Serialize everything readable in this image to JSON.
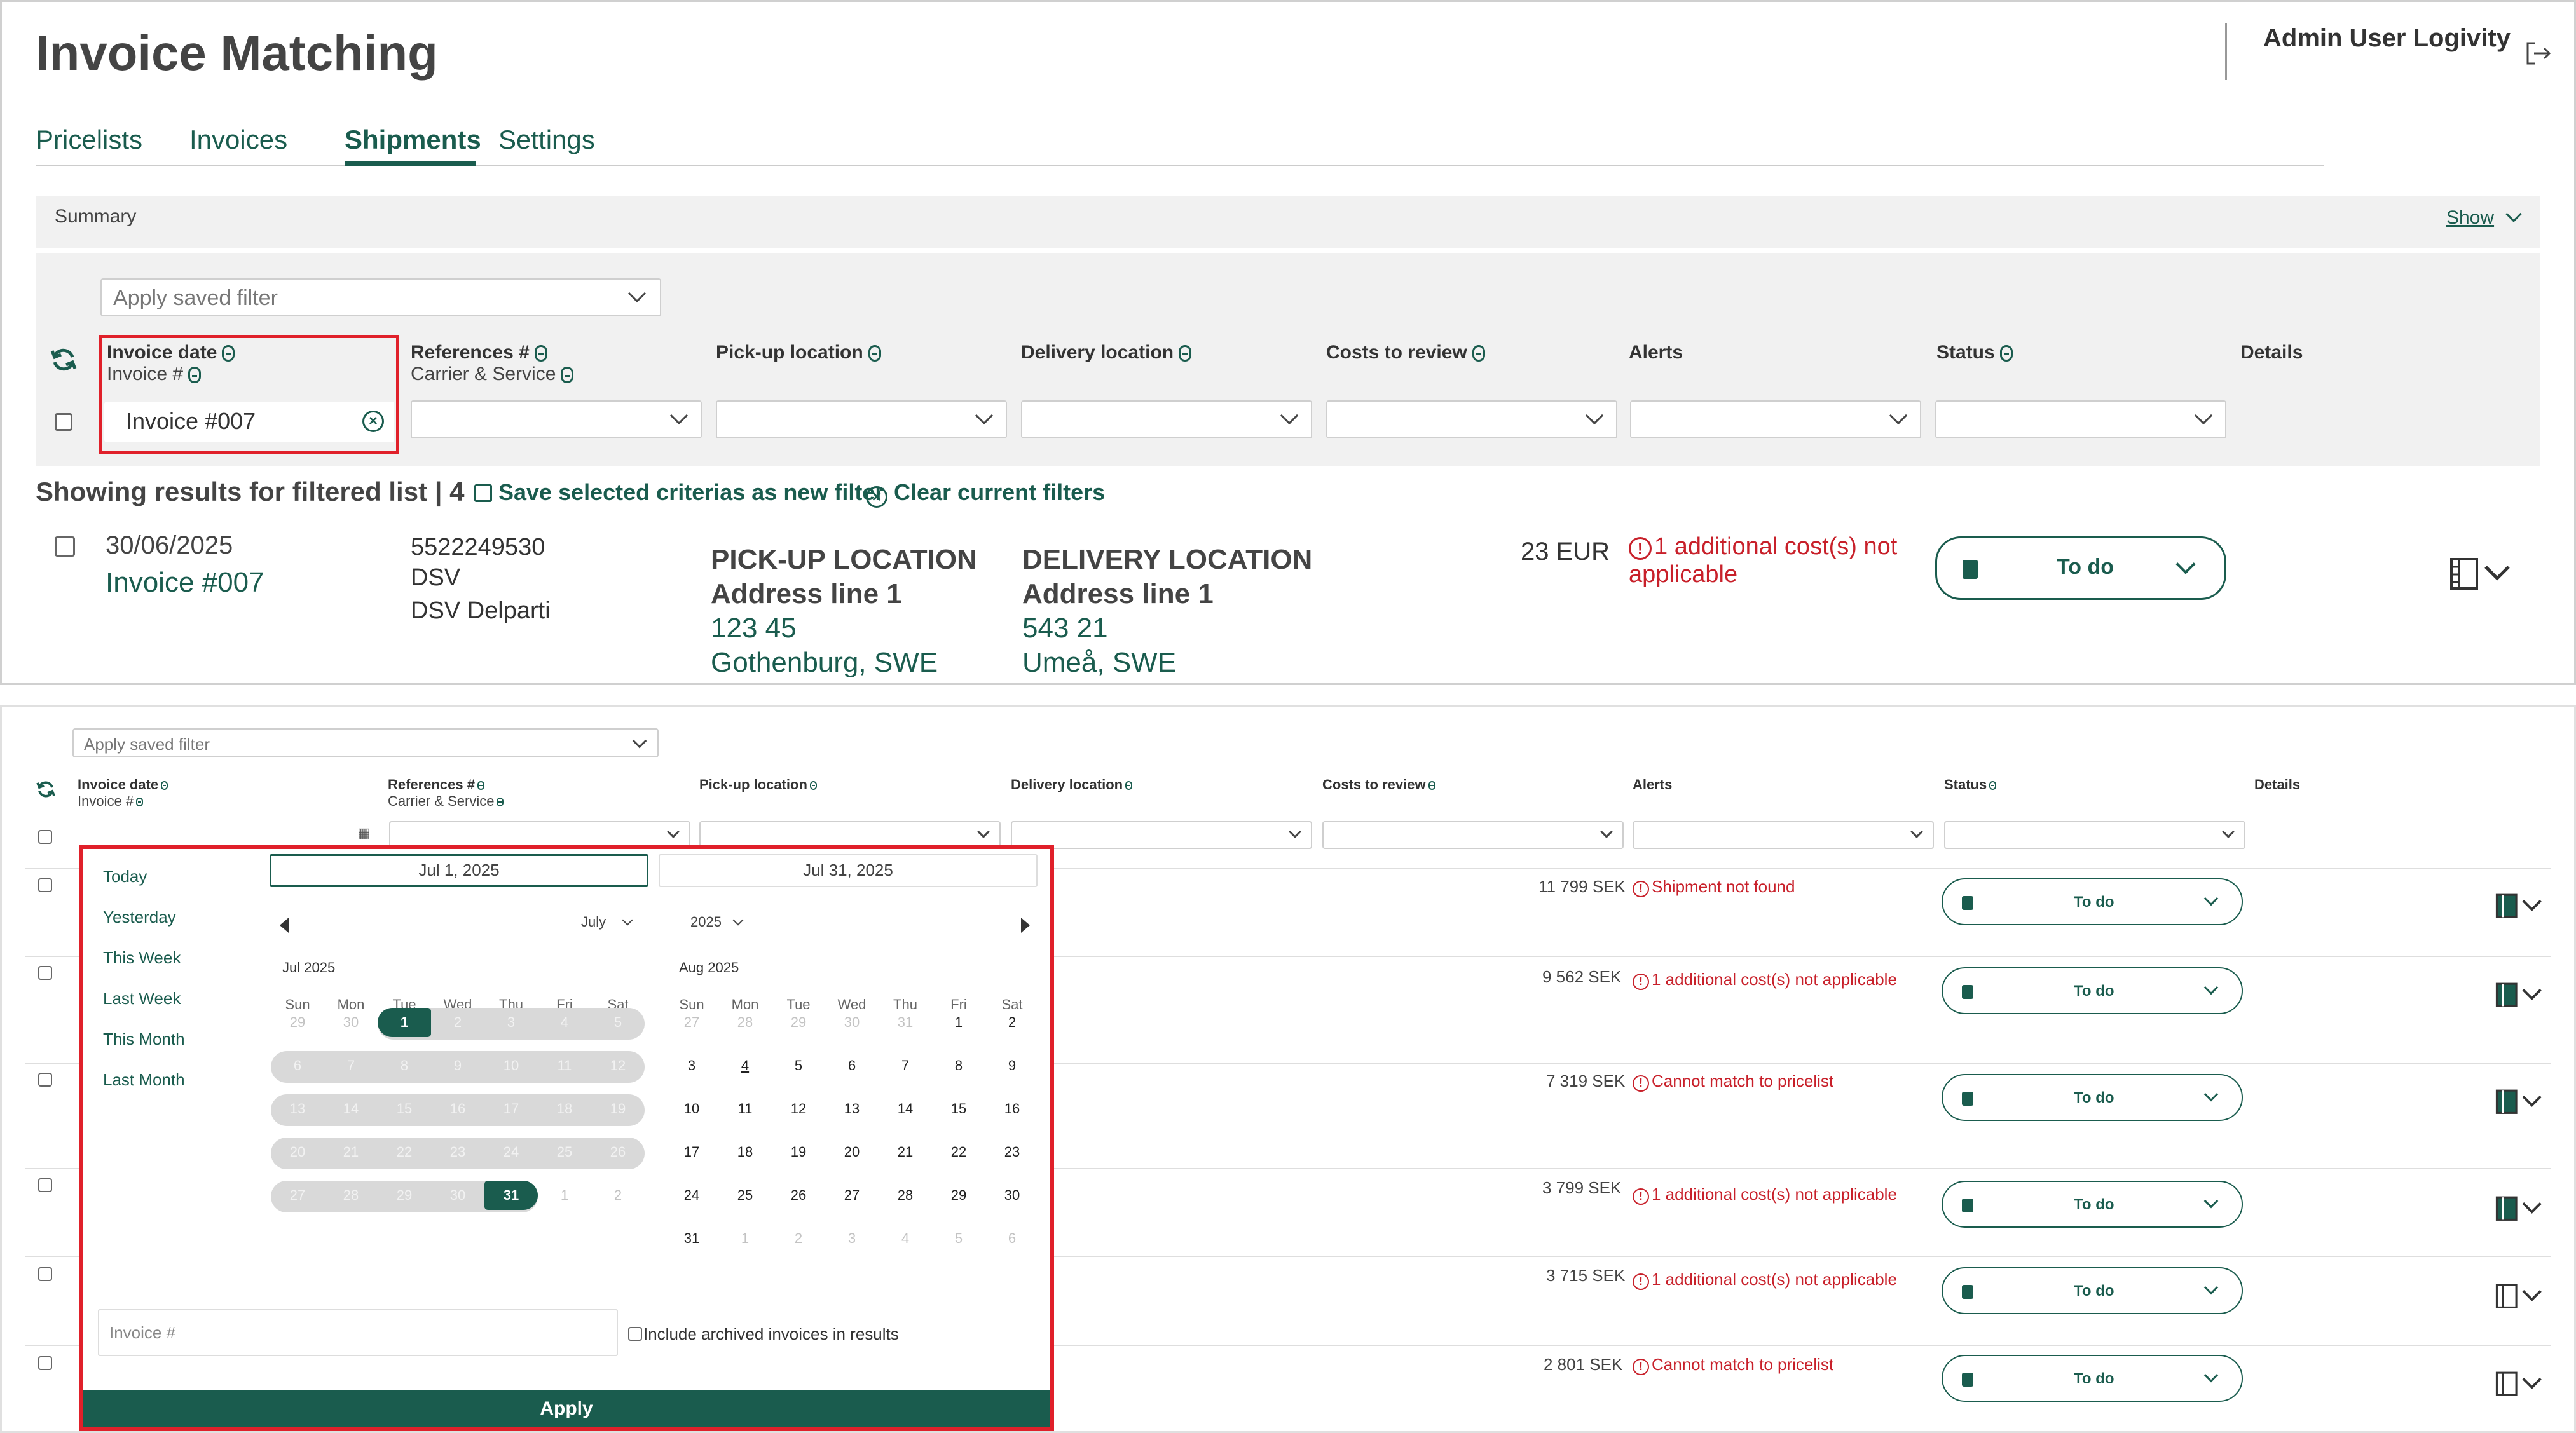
{
  "header": {
    "title": "Invoice Matching",
    "user": "Admin User Logivity"
  },
  "tabs": [
    {
      "label": "Pricelists"
    },
    {
      "label": "Invoices"
    },
    {
      "label": "Shipments",
      "active": true
    },
    {
      "label": "Settings"
    }
  ],
  "summary": {
    "label": "Summary",
    "toggle": "Show"
  },
  "filters": {
    "saved_filter_placeholder": "Apply saved filter",
    "invoice_value": "Invoice #007",
    "columns": {
      "invoice_date": "Invoice date",
      "invoice_no": "Invoice #",
      "references": "References #",
      "carrier_service": "Carrier & Service",
      "pickup": "Pick-up location",
      "delivery": "Delivery location",
      "costs": "Costs to review",
      "alerts": "Alerts",
      "status": "Status",
      "details": "Details"
    }
  },
  "results": {
    "heading": "Showing results for filtered list | 4",
    "save_filter": "Save selected criterias as new filter",
    "clear_filter": "Clear current filters"
  },
  "shipment": {
    "date": "30/06/2025",
    "invoice": "Invoice #007",
    "reference": "5522249530",
    "carrier": "DSV",
    "service": "DSV Delparti",
    "pickup": {
      "title": "PICK-UP LOCATION",
      "line1": "Address line 1",
      "zip": "123 45",
      "city": "Gothenburg, SWE"
    },
    "delivery": {
      "title": "DELIVERY LOCATION",
      "line1": "Address line 1",
      "zip": "543 21",
      "city": "Umeå, SWE"
    },
    "cost": "23 EUR",
    "alert": "1 additional cost(s) not applicable",
    "status": "To do"
  },
  "datepicker": {
    "start": "Jul 1, 2025",
    "end": "Jul 31, 2025",
    "quick_ranges": [
      "Today",
      "Yesterday",
      "This Week",
      "Last Week",
      "This Month",
      "Last Month"
    ],
    "month_select": "July",
    "year_select": "2025",
    "month1_title": "Jul 2025",
    "month2_title": "Aug 2025",
    "weekdays": [
      "Sun",
      "Mon",
      "Tue",
      "Wed",
      "Thu",
      "Fri",
      "Sat"
    ],
    "month1_days": [
      [
        "29",
        "30",
        "1",
        "2",
        "3",
        "4",
        "5"
      ],
      [
        "6",
        "7",
        "8",
        "9",
        "10",
        "11",
        "12"
      ],
      [
        "13",
        "14",
        "15",
        "16",
        "17",
        "18",
        "19"
      ],
      [
        "20",
        "21",
        "22",
        "23",
        "24",
        "25",
        "26"
      ],
      [
        "27",
        "28",
        "29",
        "30",
        "31",
        "1",
        "2"
      ]
    ],
    "month2_days": [
      [
        "27",
        "28",
        "29",
        "30",
        "31",
        "1",
        "2"
      ],
      [
        "3",
        "4",
        "5",
        "6",
        "7",
        "8",
        "9"
      ],
      [
        "10",
        "11",
        "12",
        "13",
        "14",
        "15",
        "16"
      ],
      [
        "17",
        "18",
        "19",
        "20",
        "21",
        "22",
        "23"
      ],
      [
        "24",
        "25",
        "26",
        "27",
        "28",
        "29",
        "30"
      ],
      [
        "31",
        "1",
        "2",
        "3",
        "4",
        "5",
        "6"
      ]
    ],
    "invoice_placeholder": "Invoice #",
    "archived_label": "Include archived invoices in results",
    "apply": "Apply"
  },
  "rows": [
    {
      "cost": "11 799 SEK",
      "alert": "Shipment not found",
      "status": "To do"
    },
    {
      "cost": "9 562 SEK",
      "alert": "1 additional cost(s) not applicable",
      "status": "To do"
    },
    {
      "cost": "7 319 SEK",
      "alert": "Cannot match to pricelist",
      "status": "To do"
    },
    {
      "cost": "3 799 SEK",
      "alert": "1 additional cost(s) not applicable",
      "status": "To do"
    },
    {
      "cost": "3 715 SEK",
      "alert": "1 additional cost(s) not applicable",
      "status": "To do"
    },
    {
      "cost": "2 801 SEK",
      "alert": "Cannot match to pricelist",
      "status": "To do"
    }
  ],
  "colors": {
    "brand": "#1a5c4e",
    "alert": "#c8202a",
    "highlight": "#e0202a"
  }
}
